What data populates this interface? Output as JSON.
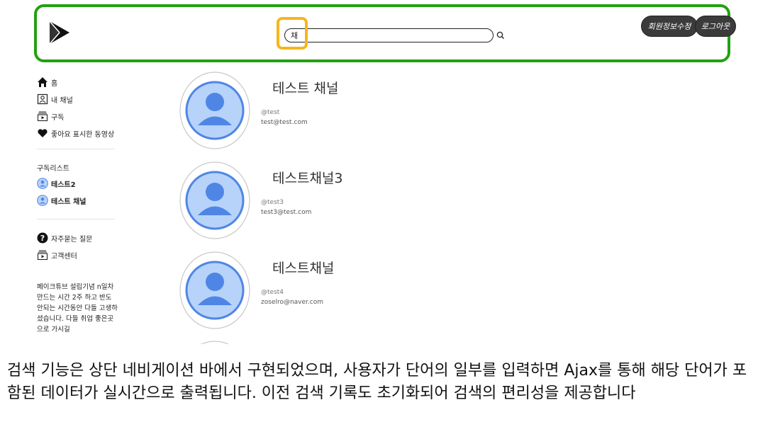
{
  "header": {
    "search": {
      "value": "채",
      "placeholder": ""
    },
    "profile_button_label": "회원정보수정",
    "logout_button_label": "로그아웃"
  },
  "sidebar": {
    "nav": [
      {
        "label": "홈",
        "icon": "home-icon"
      },
      {
        "label": "내 채널",
        "icon": "person-box-icon"
      },
      {
        "label": "구독",
        "icon": "subscription-icon"
      },
      {
        "label": "좋아요 표시한 동영상",
        "icon": "heart-icon"
      }
    ],
    "subscriptions_title": "구독리스트",
    "subscriptions": [
      {
        "label": "테스트2",
        "icon": "avatar-icon"
      },
      {
        "label": "테스트 채널",
        "icon": "avatar-icon"
      }
    ],
    "help": [
      {
        "label": "자주묻는 질문",
        "icon": "question-icon"
      },
      {
        "label": "고객센터",
        "icon": "subscription-icon"
      }
    ],
    "note": "페이크튜브 설립기념 n일차 만드는 시간 2주 하고 반도 안되는 시간동안 다들 고생하셨습니다. 다들 취업 좋은곳으로 가시길"
  },
  "results": [
    {
      "name": "테스트 채널",
      "handle": "@test",
      "email": "test@test.com"
    },
    {
      "name": "테스트채널3",
      "handle": "@test3",
      "email": "test3@test.com"
    },
    {
      "name": "테스트채널",
      "handle": "@test4",
      "email": "zoselro@naver.com"
    }
  ],
  "caption": "검색 기능은 상단 네비게이션 바에서 구현되었으며, 사용자가 단어의 일부를 입력하면 Ajax를 통해 해당 단어가 포함된 데이터가 실시간으로 출력됩니다. 이전 검색 기록도 초기화되어 검색의 편리성을 제공합니다",
  "colors": {
    "nav_border": "#22a012",
    "search_highlight": "#f6b619",
    "avatar_blue": "#4f86e6",
    "avatar_light": "#b7d3f9",
    "button_dark": "#3b3b3b"
  }
}
